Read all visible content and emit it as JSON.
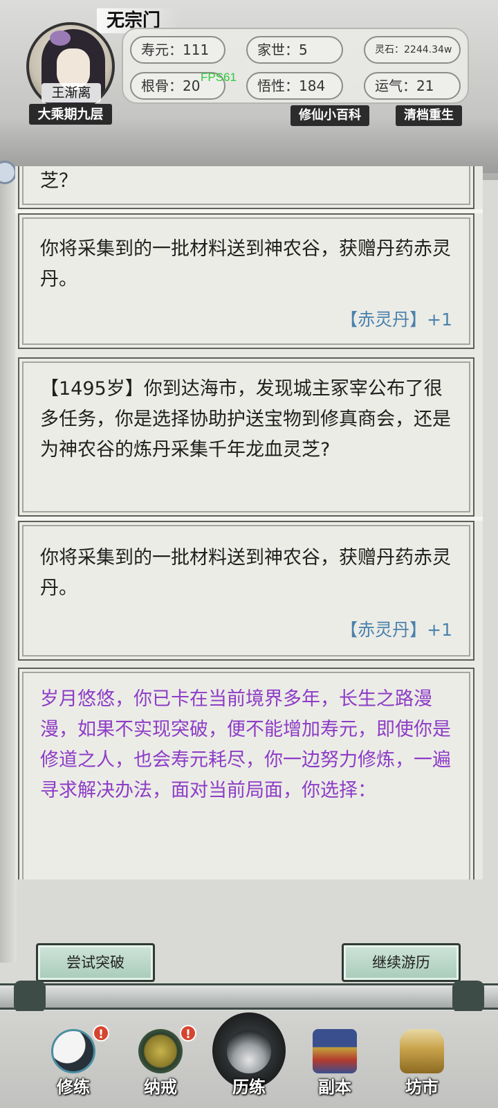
{
  "header": {
    "sect": "无宗门",
    "character_name": "王渐离",
    "realm": "大乘期九层",
    "fps": "FPS61",
    "stats": {
      "lifespan": "寿元：111",
      "family": "家世：5",
      "spirit_stone": "灵石：2244.34w",
      "root_bone": "根骨：20",
      "comprehension": "悟性：184",
      "luck": "运气：21"
    },
    "links": {
      "encyclopedia": "修仙小百科",
      "reset_rebirth": "清档重生"
    }
  },
  "log": {
    "partial_top": "芝？",
    "entry1_result": "你将采集到的一批材料送到神农谷，获赠丹药赤灵丹。",
    "entry1_reward": "【赤灵丹】+1",
    "entry2_event": "【1495岁】你到达海市，发现城主冢宰公布了很多任务，你是选择协助护送宝物到修真商会，还是为神农谷的炼丹采集千年龙血灵芝?",
    "entry2_result": "你将采集到的一批材料送到神农谷，获赠丹药赤灵丹。",
    "entry2_reward": "【赤灵丹】+1",
    "breakthrough_prompt": "岁月悠悠，你已卡在当前境界多年，长生之路漫漫，如果不实现突破，便不能增加寿元，即使你是修道之人，也会寿元耗尽，你一边努力修炼，一遍寻求解决办法，面对当前局面，你选择："
  },
  "actions": {
    "try_breakthrough": "尝试突破",
    "continue_travel": "继续游历"
  },
  "nav": {
    "items": [
      {
        "label": "修练",
        "icon": "yin-yang-icon",
        "alert": "!"
      },
      {
        "label": "纳戒",
        "icon": "ring-icon",
        "alert": "!"
      },
      {
        "label": "历练",
        "icon": "mountain-cloud-icon"
      },
      {
        "label": "副本",
        "icon": "pagoda-icon"
      },
      {
        "label": "坊市",
        "icon": "cauldron-icon"
      }
    ]
  },
  "colors": {
    "purple_text": "#8d3cc7",
    "reward_blue": "#4b82ad",
    "fps_green": "#2ec93a",
    "button_green": "#a8cbb9"
  }
}
